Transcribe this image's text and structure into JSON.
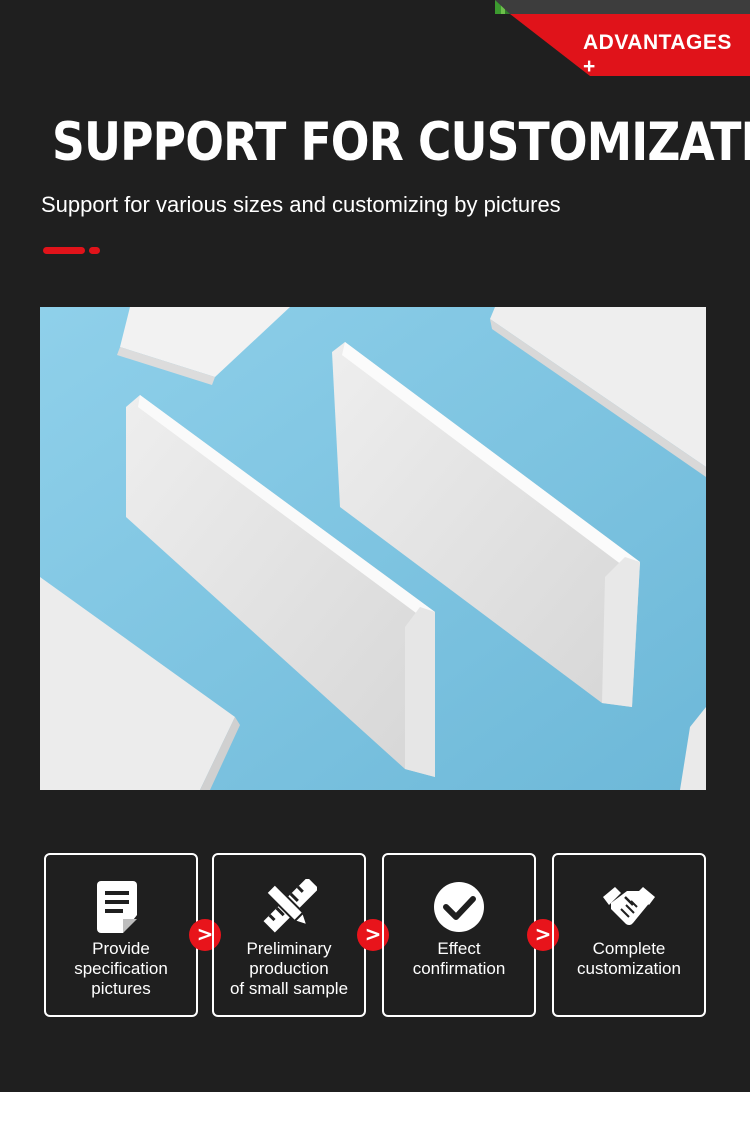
{
  "banner": {
    "label": "ADVANTAGES +"
  },
  "header": {
    "title": "SUPPORT FOR CUSTOMIZATION",
    "subtitle": "Support for various sizes and customizing by pictures"
  },
  "colors": {
    "background": "#1f1f1f",
    "accent": "#e0131a",
    "text": "#ffffff",
    "photo_bg": "#7ec4e0"
  },
  "steps": [
    {
      "icon": "document-icon",
      "lines": [
        "Provide",
        "specification",
        "pictures"
      ]
    },
    {
      "icon": "ruler-pencil-icon",
      "lines": [
        "Preliminary",
        "production",
        "of small sample"
      ]
    },
    {
      "icon": "checkmark-icon",
      "lines": [
        "Effect",
        "confirmation"
      ]
    },
    {
      "icon": "handshake-icon",
      "lines": [
        "Complete",
        "customization"
      ]
    }
  ],
  "arrows": [
    ">",
    ">",
    ">"
  ]
}
